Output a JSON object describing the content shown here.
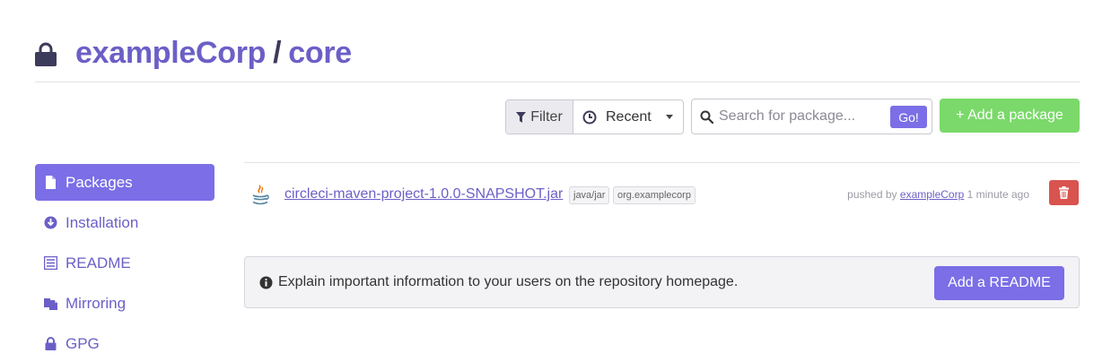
{
  "header": {
    "org": "exampleCorp",
    "separator": "/",
    "repo": "core",
    "lock_icon": "lock-icon"
  },
  "toolbar": {
    "filter_label": "Filter",
    "sort_label": "Recent",
    "search_placeholder": "Search for package...",
    "go_label": "Go!",
    "add_package_label": "+ Add a package"
  },
  "sidebar": {
    "items": [
      {
        "label": "Packages",
        "icon": "file-icon",
        "active": true
      },
      {
        "label": "Installation",
        "icon": "download-circle-icon",
        "active": false
      },
      {
        "label": "README",
        "icon": "list-icon",
        "active": false
      },
      {
        "label": "Mirroring",
        "icon": "copy-icon",
        "active": false
      },
      {
        "label": "GPG",
        "icon": "lock-icon",
        "active": false
      }
    ]
  },
  "packages": [
    {
      "name": "circleci-maven-project-1.0.0-SNAPSHOT.jar",
      "type_tag": "java/jar",
      "group_tag": "org.examplecorp",
      "pushed_prefix": "pushed by",
      "pushed_by": "exampleCorp",
      "pushed_time": "1 minute ago",
      "icon": "java-icon"
    }
  ],
  "readme_notice": {
    "text": "Explain important information to your users on the repository homepage.",
    "button_label": "Add a README"
  },
  "colors": {
    "accent": "#7b6ee6",
    "title": "#6b5fc7",
    "success": "#7ad96a",
    "danger": "#d9534f"
  }
}
